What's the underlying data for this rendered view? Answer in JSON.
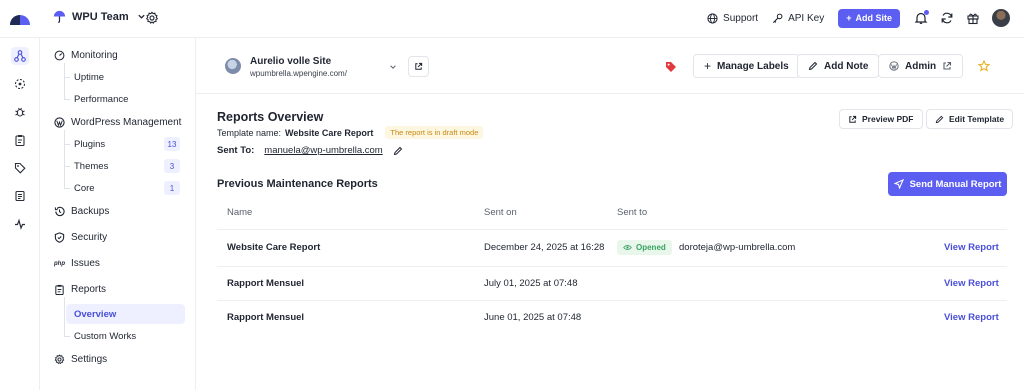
{
  "topbar": {
    "team_name": "WPU Team",
    "support": "Support",
    "api_key": "API Key",
    "add_site": "Add Site"
  },
  "sidebar": {
    "monitoring": "Monitoring",
    "uptime": "Uptime",
    "performance": "Performance",
    "wordpress_management": "WordPress Management",
    "plugins": "Plugins",
    "plugins_count": "13",
    "themes": "Themes",
    "themes_count": "3",
    "core": "Core",
    "core_count": "1",
    "backups": "Backups",
    "security": "Security",
    "php_badge": "php",
    "issues": "Issues",
    "reports": "Reports",
    "overview": "Overview",
    "custom_works": "Custom Works",
    "settings": "Settings"
  },
  "site": {
    "name": "Aurelio volle Site",
    "url": "wpumbrella.wpengine.com/",
    "manage_labels": "Manage Labels",
    "add_note": "Add Note",
    "admin": "Admin"
  },
  "reports": {
    "title": "Reports Overview",
    "template_label": "Template name:",
    "template_name": "Website Care Report",
    "draft_badge": "The report is in draft mode",
    "sent_to_label": "Sent To:",
    "sent_to_email": "manuela@wp-umbrella.com",
    "preview_pdf": "Preview PDF",
    "edit_template": "Edit Template",
    "previous_title": "Previous Maintenance Reports",
    "send_manual": "Send Manual Report",
    "columns": {
      "name": "Name",
      "sent_on": "Sent on",
      "sent_to": "Sent to"
    },
    "rows": [
      {
        "name": "Website Care Report",
        "sent_on": "December 24, 2025 at 16:28",
        "status": "Opened",
        "recipient": "doroteja@wp-umbrella.com",
        "action": "View Report"
      },
      {
        "name": "Rapport Mensuel",
        "sent_on": "July 01, 2025 at 07:48",
        "action": "View Report"
      },
      {
        "name": "Rapport Mensuel",
        "sent_on": "June 01, 2025 at 07:48",
        "action": "View Report"
      }
    ]
  },
  "colors": {
    "accent": "#5b5ef0",
    "accent_text": "#4a4fd8",
    "draft": "#c78a12",
    "opened": "#3aa361"
  },
  "icons": [
    "logo-icon",
    "umbrella-icon",
    "chevron-down-icon",
    "gear-icon",
    "globe-icon",
    "key-icon",
    "plus-icon",
    "bell-icon",
    "refresh-icon",
    "gift-icon",
    "gauge-icon",
    "wordpress-icon",
    "history-icon",
    "shield-icon",
    "clipboard-icon",
    "external-link-icon",
    "tag-icon",
    "pencil-icon",
    "star-icon",
    "send-icon",
    "eye-icon"
  ]
}
